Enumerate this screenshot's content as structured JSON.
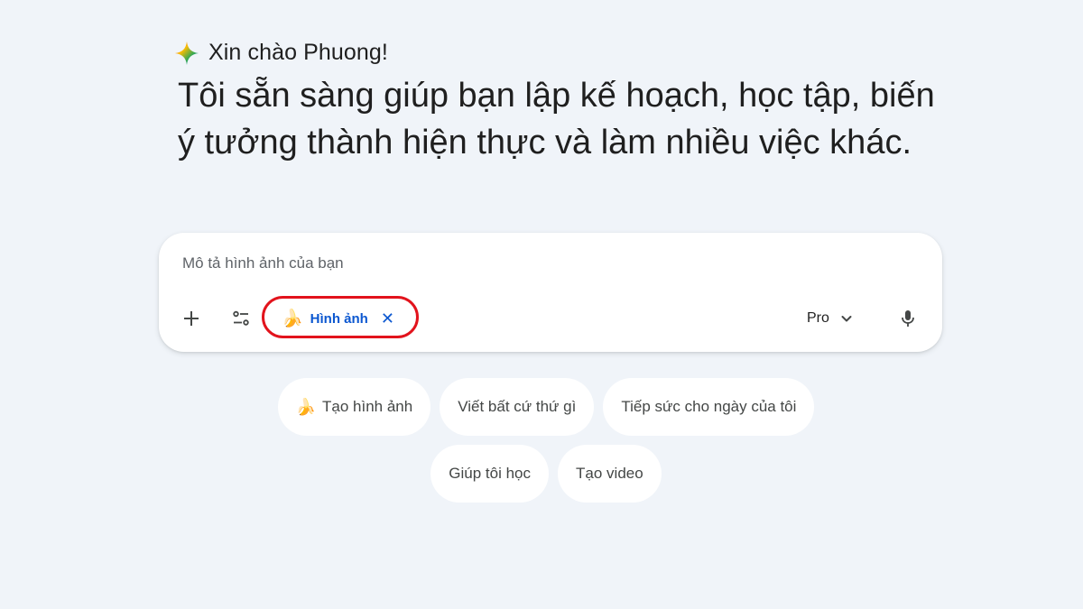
{
  "greeting": {
    "icon": "gemini-spark-icon",
    "text": "Xin chào Phuong!"
  },
  "headline": "Tôi sẵn sàng giúp bạn lập kế hoạch, học tập, biến ý tưởng thành hiện thực và làm nhiều việc khác.",
  "prompt": {
    "placeholder": "Mô tả hình ảnh của bạn",
    "value": "",
    "add_icon": "plus-icon",
    "tools_icon": "tools-icon",
    "active_tool": {
      "emoji": "🍌",
      "label": "Hình ảnh",
      "close": "✕"
    },
    "highlight_color": "#e2131c",
    "model": {
      "label": "Pro",
      "icon": "chevron-down-icon"
    },
    "mic_icon": "microphone-icon"
  },
  "suggestions": {
    "row1": [
      {
        "emoji": "🍌",
        "label": "Tạo hình ảnh"
      },
      {
        "emoji": "",
        "label": "Viết bất cứ thứ gì"
      },
      {
        "emoji": "",
        "label": "Tiếp sức cho ngày của tôi"
      }
    ],
    "row2": [
      {
        "emoji": "",
        "label": "Giúp tôi học"
      },
      {
        "emoji": "",
        "label": "Tạo video"
      }
    ]
  },
  "colors": {
    "background": "#f0f4f9",
    "accent": "#0b57d0",
    "text": "#1f1f1f"
  }
}
